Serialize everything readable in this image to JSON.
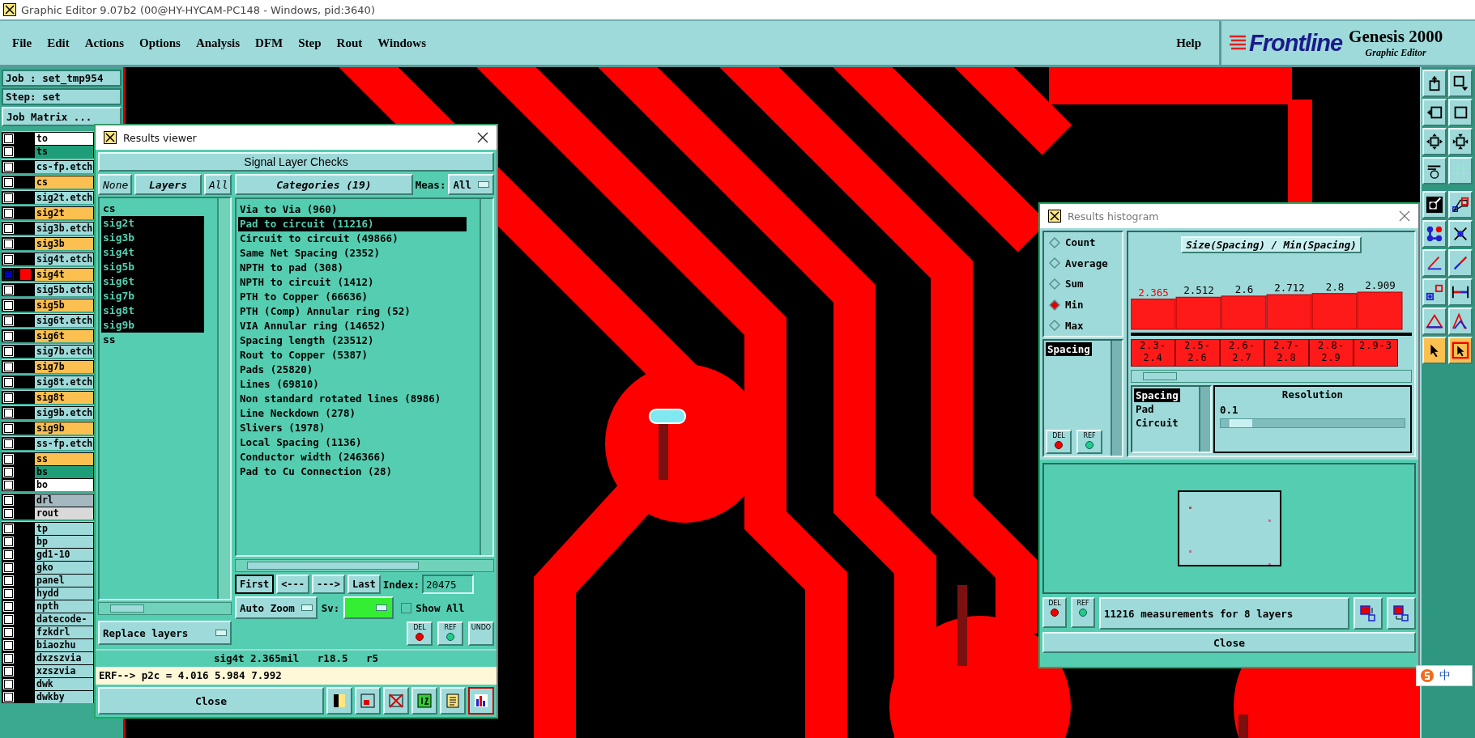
{
  "window": {
    "title": "Graphic Editor 9.07b2 (00@HY-HYCAM-PC148 - Windows, pid:3640)"
  },
  "menu": [
    "File",
    "Edit",
    "Actions",
    "Options",
    "Analysis",
    "DFM",
    "Step",
    "Rout",
    "Windows"
  ],
  "help": "Help",
  "brand": {
    "logo": "Frontline",
    "product": "Genesis 2000",
    "subtitle": "Graphic Editor"
  },
  "job": {
    "job": "Job : set_tmp954",
    "step": "Step: set",
    "matrix_button": "Job Matrix ..."
  },
  "layer_groups": [
    {
      "layers": [
        {
          "name": "to",
          "color": "#ffffff",
          "selected": false
        },
        {
          "name": "ts",
          "color": "#1e9e78",
          "selected": false
        }
      ]
    },
    {
      "layers": [
        {
          "name": "cs-fp.etch",
          "color": "#9fdada",
          "selected": false
        }
      ]
    },
    {
      "layers": [
        {
          "name": "cs",
          "color": "#fcc050",
          "selected": false
        }
      ]
    },
    {
      "layers": [
        {
          "name": "sig2t.etch",
          "color": "#9fdada",
          "selected": false
        }
      ]
    },
    {
      "layers": [
        {
          "name": "sig2t",
          "color": "#fcc050",
          "selected": false
        }
      ]
    },
    {
      "layers": [
        {
          "name": "sig3b.etch",
          "color": "#9fdada",
          "selected": false
        }
      ]
    },
    {
      "layers": [
        {
          "name": "sig3b",
          "color": "#fcc050",
          "selected": false
        }
      ]
    },
    {
      "layers": [
        {
          "name": "sig4t.etch",
          "color": "#9fdada",
          "selected": false
        }
      ]
    },
    {
      "layers": [
        {
          "name": "sig4t",
          "color": "#fcc050",
          "selected": true
        }
      ]
    },
    {
      "layers": [
        {
          "name": "sig5b.etch",
          "color": "#9fdada",
          "selected": false
        }
      ]
    },
    {
      "layers": [
        {
          "name": "sig5b",
          "color": "#fcc050",
          "selected": false
        }
      ]
    },
    {
      "layers": [
        {
          "name": "sig6t.etch",
          "color": "#9fdada",
          "selected": false
        }
      ]
    },
    {
      "layers": [
        {
          "name": "sig6t",
          "color": "#fcc050",
          "selected": false
        }
      ]
    },
    {
      "layers": [
        {
          "name": "sig7b.etch",
          "color": "#9fdada",
          "selected": false
        }
      ]
    },
    {
      "layers": [
        {
          "name": "sig7b",
          "color": "#fcc050",
          "selected": false
        }
      ]
    },
    {
      "layers": [
        {
          "name": "sig8t.etch",
          "color": "#9fdada",
          "selected": false
        }
      ]
    },
    {
      "layers": [
        {
          "name": "sig8t",
          "color": "#fcc050",
          "selected": false
        }
      ]
    },
    {
      "layers": [
        {
          "name": "sig9b.etch",
          "color": "#9fdada",
          "selected": false
        }
      ]
    },
    {
      "layers": [
        {
          "name": "sig9b",
          "color": "#fcc050",
          "selected": false
        }
      ]
    },
    {
      "layers": [
        {
          "name": "ss-fp.etch",
          "color": "#9fdada",
          "selected": false
        }
      ]
    },
    {
      "layers": [
        {
          "name": "ss",
          "color": "#fcc050",
          "selected": false
        },
        {
          "name": "bs",
          "color": "#1e9e78",
          "selected": false
        },
        {
          "name": "bo",
          "color": "#ffffff",
          "selected": false
        }
      ]
    },
    {
      "layers": [
        {
          "name": "drl",
          "color": "#a4b8c0",
          "selected": false
        },
        {
          "name": "rout",
          "color": "#d9d9d9",
          "selected": false
        }
      ]
    },
    {
      "layers": [
        {
          "name": "tp",
          "color": "#9fdada",
          "selected": false
        },
        {
          "name": "bp",
          "color": "#9fdada",
          "selected": false
        },
        {
          "name": "gd1-10",
          "color": "#9fdada",
          "selected": false
        },
        {
          "name": "gko",
          "color": "#9fdada",
          "selected": false
        },
        {
          "name": "panel",
          "color": "#9fdada",
          "selected": false
        },
        {
          "name": "hydd",
          "color": "#9fdada",
          "selected": false
        },
        {
          "name": "npth",
          "color": "#9fdada",
          "selected": false
        },
        {
          "name": "datecode-",
          "color": "#9fdada",
          "selected": false
        },
        {
          "name": "fzkdrl",
          "color": "#9fdada",
          "selected": false
        },
        {
          "name": "biaozhu",
          "color": "#9fdada",
          "selected": false
        },
        {
          "name": "dxzszvia",
          "color": "#9fdada",
          "selected": false
        },
        {
          "name": "xzszvia",
          "color": "#9fdada",
          "selected": false
        },
        {
          "name": "dwk",
          "color": "#9fdada",
          "selected": false
        },
        {
          "name": "dwkby",
          "color": "#9fdada",
          "selected": false
        }
      ]
    }
  ],
  "results_viewer": {
    "title": "Results viewer",
    "header": "Signal Layer Checks",
    "layer_buttons": [
      "None",
      "Layers",
      "All"
    ],
    "layers": [
      {
        "name": "cs",
        "selected": false
      },
      {
        "name": "sig2t",
        "selected": true
      },
      {
        "name": "sig3b",
        "selected": true
      },
      {
        "name": "sig4t",
        "selected": true
      },
      {
        "name": "sig5b",
        "selected": true
      },
      {
        "name": "sig6t",
        "selected": true
      },
      {
        "name": "sig7b",
        "selected": true
      },
      {
        "name": "sig8t",
        "selected": true
      },
      {
        "name": "sig9b",
        "selected": true
      },
      {
        "name": "ss",
        "selected": false
      }
    ],
    "categories_button": "Categories (19)",
    "meas_label": "Meas:",
    "meas_value": "All",
    "categories": [
      {
        "name": "Via to Via (960)",
        "selected": false
      },
      {
        "name": "Pad to circuit (11216)",
        "selected": true
      },
      {
        "name": "Circuit to circuit (49866)",
        "selected": false
      },
      {
        "name": "Same Net Spacing (2352)",
        "selected": false
      },
      {
        "name": "NPTH to pad (308)",
        "selected": false
      },
      {
        "name": "NPTH to circuit (1412)",
        "selected": false
      },
      {
        "name": "PTH to Copper (66636)",
        "selected": false
      },
      {
        "name": "PTH (Comp) Annular ring (52)",
        "selected": false
      },
      {
        "name": "VIA Annular ring (14652)",
        "selected": false
      },
      {
        "name": "Spacing length (23512)",
        "selected": false
      },
      {
        "name": "Rout to Copper (5387)",
        "selected": false
      },
      {
        "name": "Pads (25820)",
        "selected": false
      },
      {
        "name": "Lines (69810)",
        "selected": false
      },
      {
        "name": "Non standard rotated lines (8986)",
        "selected": false
      },
      {
        "name": "Line Neckdown (278)",
        "selected": false
      },
      {
        "name": "Slivers (1978)",
        "selected": false
      },
      {
        "name": "Local Spacing (1136)",
        "selected": false
      },
      {
        "name": "Conductor width (246366)",
        "selected": false
      },
      {
        "name": "Pad to Cu Connection (28)",
        "selected": false
      }
    ],
    "nav": [
      "First",
      "<---",
      "--->",
      "Last"
    ],
    "index_label": "Index:",
    "index_value": "20475",
    "zoom_mode": "Auto Zoom",
    "sv_label": "Sv:",
    "show_all": {
      "label": "Show All",
      "checked": false
    },
    "actions": [
      "DEL",
      "REF",
      "UNDO"
    ],
    "replace_mode": "Replace layers",
    "status": "sig4t 2.365mil   r18.5   r5",
    "erf": "ERF--> p2c = 4.016 5.984 7.992",
    "close": "Close"
  },
  "histogram": {
    "title": "Results histogram",
    "modes": [
      {
        "label": "Count",
        "selected": false
      },
      {
        "label": "Average",
        "selected": false
      },
      {
        "label": "Sum",
        "selected": false
      },
      {
        "label": "Min",
        "selected": true
      },
      {
        "label": "Max",
        "selected": false
      }
    ],
    "attributes": [
      {
        "name": "Spacing",
        "selected": true
      }
    ],
    "attribute_actions": [
      "DEL",
      "REF"
    ],
    "chart_title": "Size(Spacing) / Min(Spacing)",
    "chart_data": {
      "type": "bar",
      "categories": [
        "2.3-2.4",
        "2.5-2.6",
        "2.6-2.7",
        "2.7-2.8",
        "2.8-2.9",
        "2.9-3"
      ],
      "values": [
        2.365,
        2.512,
        2.6,
        2.712,
        2.8,
        2.909
      ],
      "data_labels": true
    },
    "fields": [
      {
        "name": "Spacing",
        "selected": true
      },
      {
        "name": "Pad",
        "selected": false
      },
      {
        "name": "Circuit",
        "selected": false
      }
    ],
    "resolution_label": "Resolution",
    "resolution_value": "0.1",
    "resolution": {
      "level": 0.05
    },
    "summary_actions": [
      "DEL",
      "REF"
    ],
    "summary": "11216 measurements for 8 layers",
    "close": "Close"
  },
  "ime": {
    "label": "中"
  }
}
